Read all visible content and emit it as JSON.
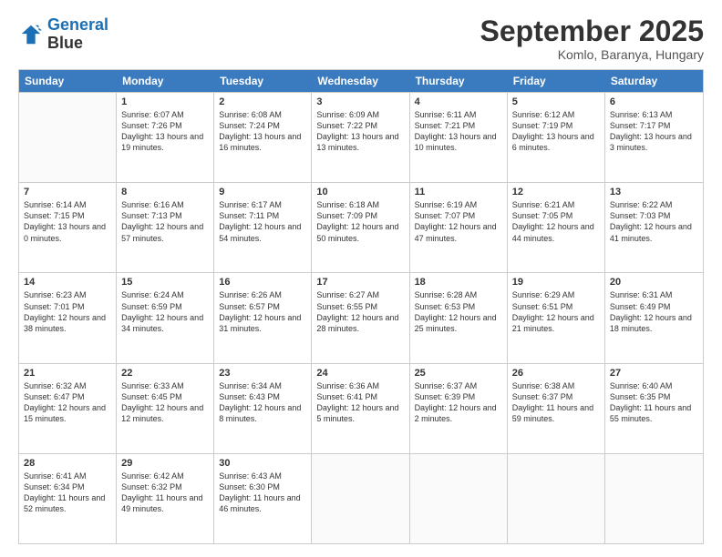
{
  "logo": {
    "line1": "General",
    "line2": "Blue"
  },
  "title": "September 2025",
  "location": "Komlo, Baranya, Hungary",
  "header_days": [
    "Sunday",
    "Monday",
    "Tuesday",
    "Wednesday",
    "Thursday",
    "Friday",
    "Saturday"
  ],
  "weeks": [
    [
      {
        "day": "",
        "sunrise": "",
        "sunset": "",
        "daylight": ""
      },
      {
        "day": "1",
        "sunrise": "Sunrise: 6:07 AM",
        "sunset": "Sunset: 7:26 PM",
        "daylight": "Daylight: 13 hours and 19 minutes."
      },
      {
        "day": "2",
        "sunrise": "Sunrise: 6:08 AM",
        "sunset": "Sunset: 7:24 PM",
        "daylight": "Daylight: 13 hours and 16 minutes."
      },
      {
        "day": "3",
        "sunrise": "Sunrise: 6:09 AM",
        "sunset": "Sunset: 7:22 PM",
        "daylight": "Daylight: 13 hours and 13 minutes."
      },
      {
        "day": "4",
        "sunrise": "Sunrise: 6:11 AM",
        "sunset": "Sunset: 7:21 PM",
        "daylight": "Daylight: 13 hours and 10 minutes."
      },
      {
        "day": "5",
        "sunrise": "Sunrise: 6:12 AM",
        "sunset": "Sunset: 7:19 PM",
        "daylight": "Daylight: 13 hours and 6 minutes."
      },
      {
        "day": "6",
        "sunrise": "Sunrise: 6:13 AM",
        "sunset": "Sunset: 7:17 PM",
        "daylight": "Daylight: 13 hours and 3 minutes."
      }
    ],
    [
      {
        "day": "7",
        "sunrise": "Sunrise: 6:14 AM",
        "sunset": "Sunset: 7:15 PM",
        "daylight": "Daylight: 13 hours and 0 minutes."
      },
      {
        "day": "8",
        "sunrise": "Sunrise: 6:16 AM",
        "sunset": "Sunset: 7:13 PM",
        "daylight": "Daylight: 12 hours and 57 minutes."
      },
      {
        "day": "9",
        "sunrise": "Sunrise: 6:17 AM",
        "sunset": "Sunset: 7:11 PM",
        "daylight": "Daylight: 12 hours and 54 minutes."
      },
      {
        "day": "10",
        "sunrise": "Sunrise: 6:18 AM",
        "sunset": "Sunset: 7:09 PM",
        "daylight": "Daylight: 12 hours and 50 minutes."
      },
      {
        "day": "11",
        "sunrise": "Sunrise: 6:19 AM",
        "sunset": "Sunset: 7:07 PM",
        "daylight": "Daylight: 12 hours and 47 minutes."
      },
      {
        "day": "12",
        "sunrise": "Sunrise: 6:21 AM",
        "sunset": "Sunset: 7:05 PM",
        "daylight": "Daylight: 12 hours and 44 minutes."
      },
      {
        "day": "13",
        "sunrise": "Sunrise: 6:22 AM",
        "sunset": "Sunset: 7:03 PM",
        "daylight": "Daylight: 12 hours and 41 minutes."
      }
    ],
    [
      {
        "day": "14",
        "sunrise": "Sunrise: 6:23 AM",
        "sunset": "Sunset: 7:01 PM",
        "daylight": "Daylight: 12 hours and 38 minutes."
      },
      {
        "day": "15",
        "sunrise": "Sunrise: 6:24 AM",
        "sunset": "Sunset: 6:59 PM",
        "daylight": "Daylight: 12 hours and 34 minutes."
      },
      {
        "day": "16",
        "sunrise": "Sunrise: 6:26 AM",
        "sunset": "Sunset: 6:57 PM",
        "daylight": "Daylight: 12 hours and 31 minutes."
      },
      {
        "day": "17",
        "sunrise": "Sunrise: 6:27 AM",
        "sunset": "Sunset: 6:55 PM",
        "daylight": "Daylight: 12 hours and 28 minutes."
      },
      {
        "day": "18",
        "sunrise": "Sunrise: 6:28 AM",
        "sunset": "Sunset: 6:53 PM",
        "daylight": "Daylight: 12 hours and 25 minutes."
      },
      {
        "day": "19",
        "sunrise": "Sunrise: 6:29 AM",
        "sunset": "Sunset: 6:51 PM",
        "daylight": "Daylight: 12 hours and 21 minutes."
      },
      {
        "day": "20",
        "sunrise": "Sunrise: 6:31 AM",
        "sunset": "Sunset: 6:49 PM",
        "daylight": "Daylight: 12 hours and 18 minutes."
      }
    ],
    [
      {
        "day": "21",
        "sunrise": "Sunrise: 6:32 AM",
        "sunset": "Sunset: 6:47 PM",
        "daylight": "Daylight: 12 hours and 15 minutes."
      },
      {
        "day": "22",
        "sunrise": "Sunrise: 6:33 AM",
        "sunset": "Sunset: 6:45 PM",
        "daylight": "Daylight: 12 hours and 12 minutes."
      },
      {
        "day": "23",
        "sunrise": "Sunrise: 6:34 AM",
        "sunset": "Sunset: 6:43 PM",
        "daylight": "Daylight: 12 hours and 8 minutes."
      },
      {
        "day": "24",
        "sunrise": "Sunrise: 6:36 AM",
        "sunset": "Sunset: 6:41 PM",
        "daylight": "Daylight: 12 hours and 5 minutes."
      },
      {
        "day": "25",
        "sunrise": "Sunrise: 6:37 AM",
        "sunset": "Sunset: 6:39 PM",
        "daylight": "Daylight: 12 hours and 2 minutes."
      },
      {
        "day": "26",
        "sunrise": "Sunrise: 6:38 AM",
        "sunset": "Sunset: 6:37 PM",
        "daylight": "Daylight: 11 hours and 59 minutes."
      },
      {
        "day": "27",
        "sunrise": "Sunrise: 6:40 AM",
        "sunset": "Sunset: 6:35 PM",
        "daylight": "Daylight: 11 hours and 55 minutes."
      }
    ],
    [
      {
        "day": "28",
        "sunrise": "Sunrise: 6:41 AM",
        "sunset": "Sunset: 6:34 PM",
        "daylight": "Daylight: 11 hours and 52 minutes."
      },
      {
        "day": "29",
        "sunrise": "Sunrise: 6:42 AM",
        "sunset": "Sunset: 6:32 PM",
        "daylight": "Daylight: 11 hours and 49 minutes."
      },
      {
        "day": "30",
        "sunrise": "Sunrise: 6:43 AM",
        "sunset": "Sunset: 6:30 PM",
        "daylight": "Daylight: 11 hours and 46 minutes."
      },
      {
        "day": "",
        "sunrise": "",
        "sunset": "",
        "daylight": ""
      },
      {
        "day": "",
        "sunrise": "",
        "sunset": "",
        "daylight": ""
      },
      {
        "day": "",
        "sunrise": "",
        "sunset": "",
        "daylight": ""
      },
      {
        "day": "",
        "sunrise": "",
        "sunset": "",
        "daylight": ""
      }
    ]
  ]
}
